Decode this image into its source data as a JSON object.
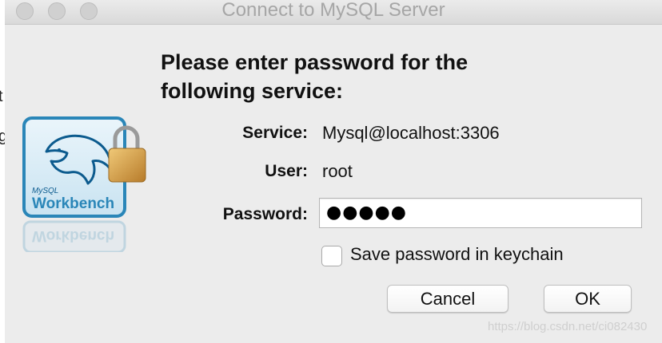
{
  "window": {
    "title": "Connect to MySQL Server"
  },
  "background_fragments": [
    "t",
    "g"
  ],
  "prompt": {
    "line1": "Please enter password for the",
    "line2": "following service:"
  },
  "fields": {
    "service_label": "Service:",
    "service_value": "Mysql@localhost:3306",
    "user_label": "User:",
    "user_value": "root",
    "password_label": "Password:",
    "password_value": "●●●●●"
  },
  "save_option": {
    "label": "Save password in keychain",
    "checked": false
  },
  "buttons": {
    "cancel": "Cancel",
    "ok": "OK"
  },
  "logo": {
    "brand_small": "MySQL",
    "brand_main": "Workbench"
  },
  "watermark": "https://blog.csdn.net/ci082430",
  "colors": {
    "logo_blue": "#2a86b8",
    "logo_dark_blue": "#0c5b8e",
    "lock_gold": "#d9a441"
  }
}
